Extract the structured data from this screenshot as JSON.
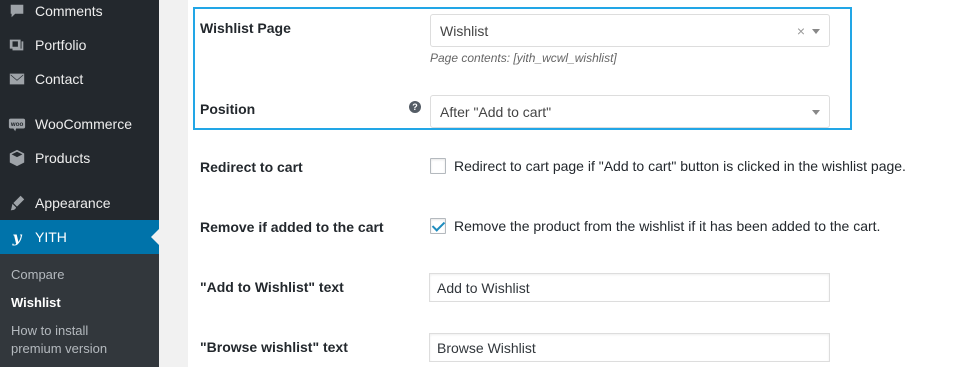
{
  "sidebar": {
    "items": [
      {
        "label": "Comments",
        "icon": "comments-icon"
      },
      {
        "label": "Portfolio",
        "icon": "portfolio-icon"
      },
      {
        "label": "Contact",
        "icon": "contact-icon"
      },
      {
        "label": "WooCommerce",
        "icon": "woocommerce-icon"
      },
      {
        "label": "Products",
        "icon": "products-icon"
      },
      {
        "label": "Appearance",
        "icon": "appearance-icon"
      },
      {
        "label": "YITH",
        "icon": "yith-icon",
        "active": true
      }
    ],
    "submenu": [
      {
        "label": "Compare"
      },
      {
        "label": "Wishlist",
        "current": true
      },
      {
        "label": "How to install"
      },
      {
        "label": "premium version"
      }
    ]
  },
  "settings": {
    "wishlist_page": {
      "label": "Wishlist Page",
      "value": "Wishlist",
      "description": "Page contents: [yith_wcwl_wishlist]"
    },
    "position": {
      "label": "Position",
      "value": "After \"Add to cart\"",
      "help": "?"
    },
    "redirect": {
      "label": "Redirect to cart",
      "checkbox_label": "Redirect to cart page if \"Add to cart\" button is clicked in the wishlist page.",
      "checked": false
    },
    "remove": {
      "label": "Remove if added to the cart",
      "checkbox_label": "Remove the product from the wishlist if it has been added to the cart.",
      "checked": true
    },
    "add_text": {
      "label": "\"Add to Wishlist\" text",
      "value": "Add to Wishlist"
    },
    "browse_text": {
      "label": "\"Browse wishlist\" text",
      "value": "Browse Wishlist"
    }
  },
  "colors": {
    "sidebar_bg": "#23282d",
    "active": "#0073aa",
    "highlight": "#22a6e6"
  }
}
